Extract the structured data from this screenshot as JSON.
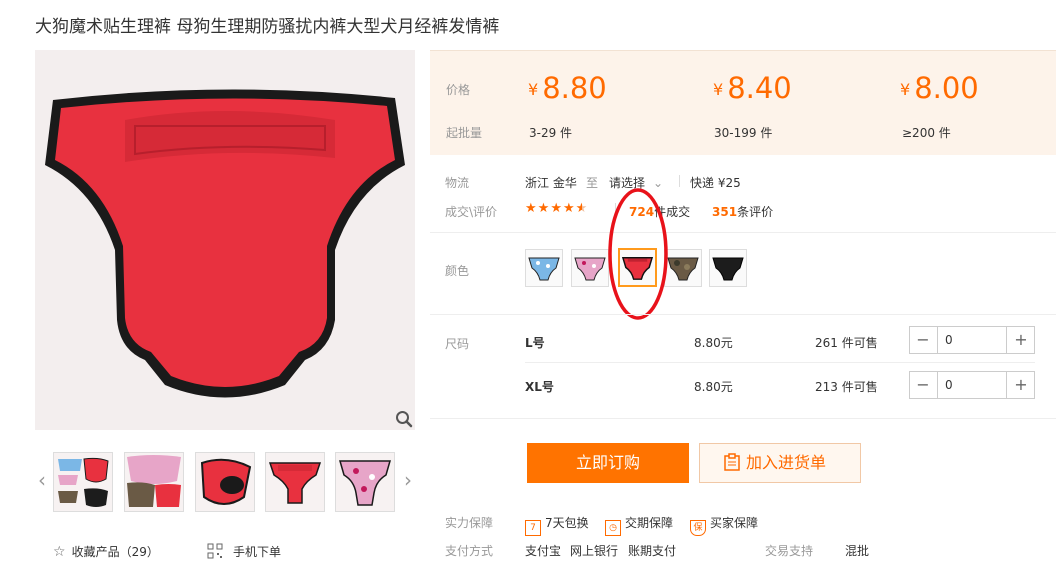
{
  "product": {
    "title": "大狗魔术贴生理裤 母狗生理期防骚扰内裤大型犬月经裤发情裤"
  },
  "gallery": {
    "favorite_label": "收藏产品（29）",
    "mobile_label": "手机下单",
    "main_color": "#e8313f"
  },
  "price": {
    "price_label": "价格",
    "moq_label": "起批量",
    "currency": "¥",
    "tiers": [
      {
        "price": "8.80",
        "range": "3-29 件"
      },
      {
        "price": "8.40",
        "range": "30-199 件"
      },
      {
        "price": "8.00",
        "range": "≥200 件"
      }
    ],
    "accent": "#ff6a00"
  },
  "logistics": {
    "label": "物流",
    "origin": "浙江 金华",
    "to": "至",
    "dest": "请选择",
    "express": "快递 ¥25"
  },
  "deals": {
    "label": "成交\\评价",
    "rating": 4.5,
    "count": "724",
    "count_suffix": "件成交",
    "reviews": "351",
    "reviews_suffix": "条评价"
  },
  "color": {
    "label": "颜色",
    "swatches": [
      "#7bb7e6",
      "#e7a5c8",
      "#e8313f",
      "#6a5a45",
      "#1c1c1c"
    ],
    "selected": 2
  },
  "size": {
    "label": "尺码",
    "rows": [
      {
        "name": "L号",
        "price": "8.80元",
        "stock": "261 件可售",
        "qty": "0"
      },
      {
        "name": "XL号",
        "price": "8.80元",
        "stock": "213 件可售",
        "qty": "0"
      }
    ]
  },
  "actions": {
    "order": "立即订购",
    "cart": "加入进货单"
  },
  "assurance": {
    "label": "实力保障",
    "items": [
      "7天包换",
      "交期保障",
      "买家保障"
    ]
  },
  "payment": {
    "label": "支付方式",
    "methods": [
      "支付宝",
      "网上银行",
      "账期支付"
    ],
    "support_label": "交易支持",
    "support_value": "混批"
  }
}
